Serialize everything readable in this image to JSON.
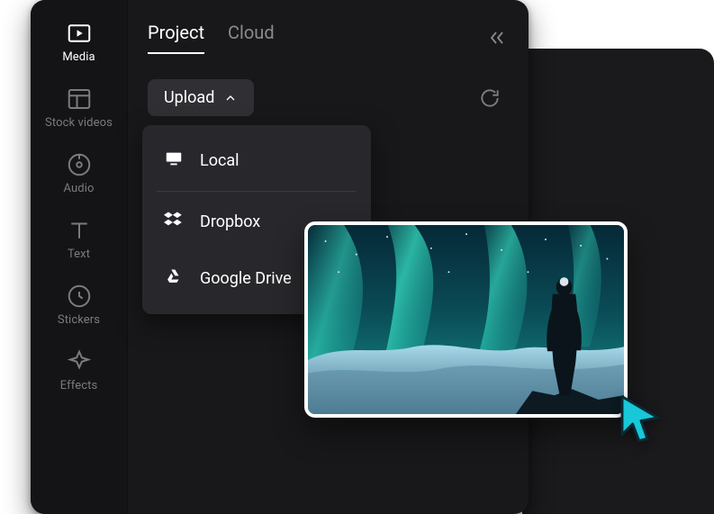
{
  "sidebar": {
    "items": [
      {
        "label": "Media"
      },
      {
        "label": "Stock videos"
      },
      {
        "label": "Audio"
      },
      {
        "label": "Text"
      },
      {
        "label": "Stickers"
      },
      {
        "label": "Effects"
      }
    ]
  },
  "panel": {
    "tabs": [
      {
        "label": "Project"
      },
      {
        "label": "Cloud"
      }
    ],
    "upload_label": "Upload",
    "upload_menu": [
      {
        "label": "Local"
      },
      {
        "label": "Dropbox"
      },
      {
        "label": "Google Drive"
      }
    ]
  }
}
